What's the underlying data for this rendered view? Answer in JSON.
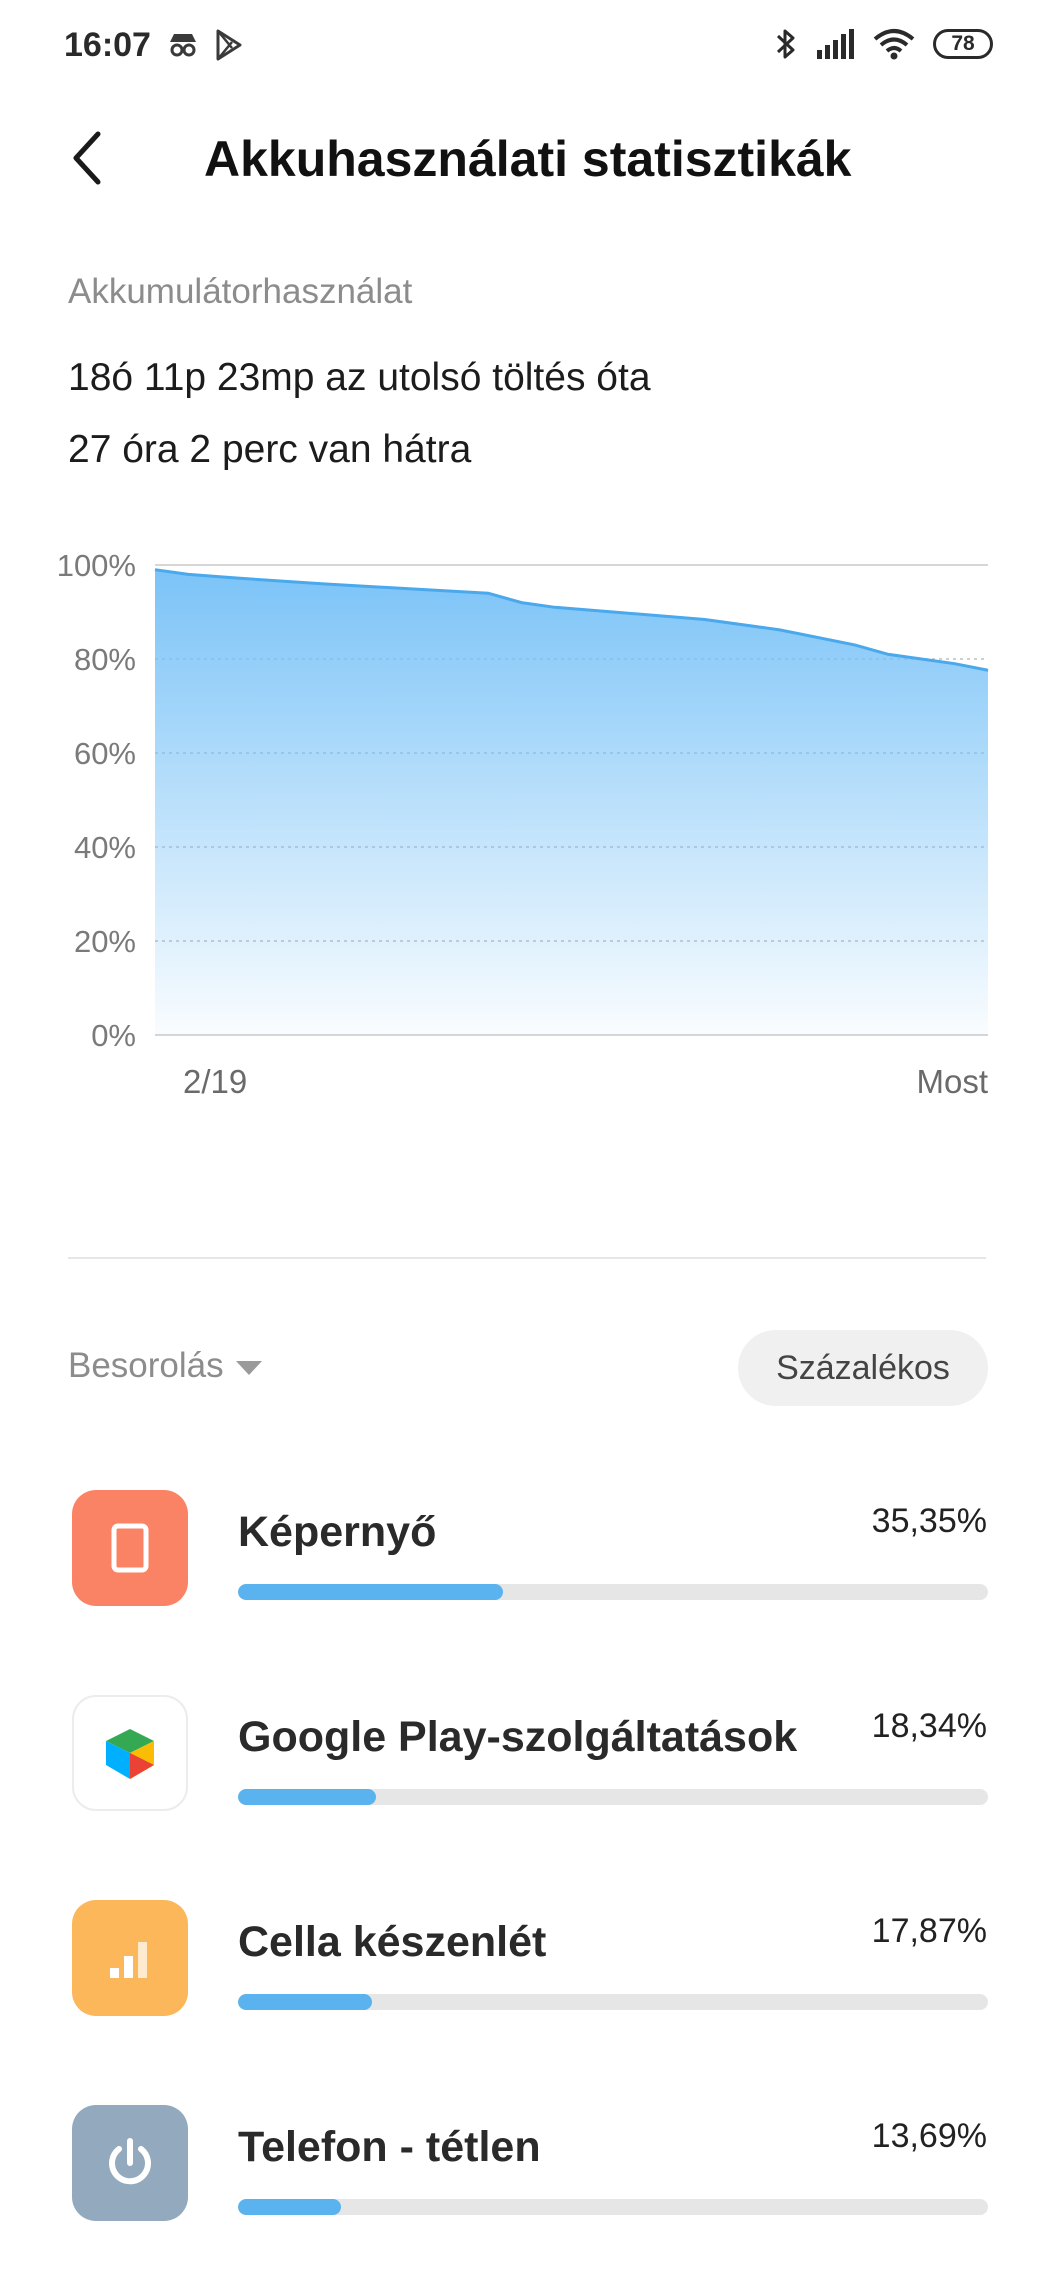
{
  "status_bar": {
    "time": "16:07",
    "left_icons": [
      "incognito-icon",
      "play-store-icon"
    ],
    "right_icons": [
      "bluetooth-icon",
      "signal-icon",
      "wifi-icon"
    ],
    "battery_level": "78"
  },
  "header": {
    "title": "Akkuhasználati statisztikák",
    "back_icon": "back-arrow-icon"
  },
  "usage": {
    "section_label": "Akkumulátorhasználat",
    "since_last_charge": "18ó 11p 23mp az utolsó töltés óta",
    "remaining": "27 óra 2 perc van hátra"
  },
  "chart_data": {
    "type": "area",
    "y_tick_labels": [
      "100%",
      "80%",
      "60%",
      "40%",
      "20%",
      "0%"
    ],
    "ylim": [
      0,
      100
    ],
    "x_tick_labels": [
      "2/19",
      "Most"
    ],
    "x": [
      0,
      0.04,
      0.1,
      0.2,
      0.3,
      0.4,
      0.44,
      0.48,
      0.55,
      0.66,
      0.75,
      0.84,
      0.88,
      0.92,
      0.96,
      1.0
    ],
    "values": [
      99,
      98,
      97.2,
      96,
      95,
      94,
      92,
      91,
      90,
      88.4,
      86.2,
      83,
      81,
      80,
      79,
      77.6
    ],
    "fill_color": "#74c0f7",
    "line_color": "#4aa8ec",
    "grid": true
  },
  "sort": {
    "label": "Besorolás",
    "caret_icon": "dropdown-caret-icon",
    "mode_button": "Százalékos"
  },
  "apps": [
    {
      "name": "Képernyő",
      "percent": "35,35%",
      "value": 35.35,
      "icon": "screen-icon",
      "icon_color": "#fb8365"
    },
    {
      "name": "Google Play-szolgáltatások",
      "percent": "18,34%",
      "value": 18.34,
      "icon": "google-play-services-icon",
      "icon_color": "#ffffff"
    },
    {
      "name": "Cella készenlét",
      "percent": "17,87%",
      "value": 17.87,
      "icon": "cell-standby-icon",
      "icon_color": "#fbb75a"
    },
    {
      "name": "Telefon - tétlen",
      "percent": "13,69%",
      "value": 13.69,
      "icon": "power-icon",
      "icon_color": "#93a9bd"
    }
  ]
}
